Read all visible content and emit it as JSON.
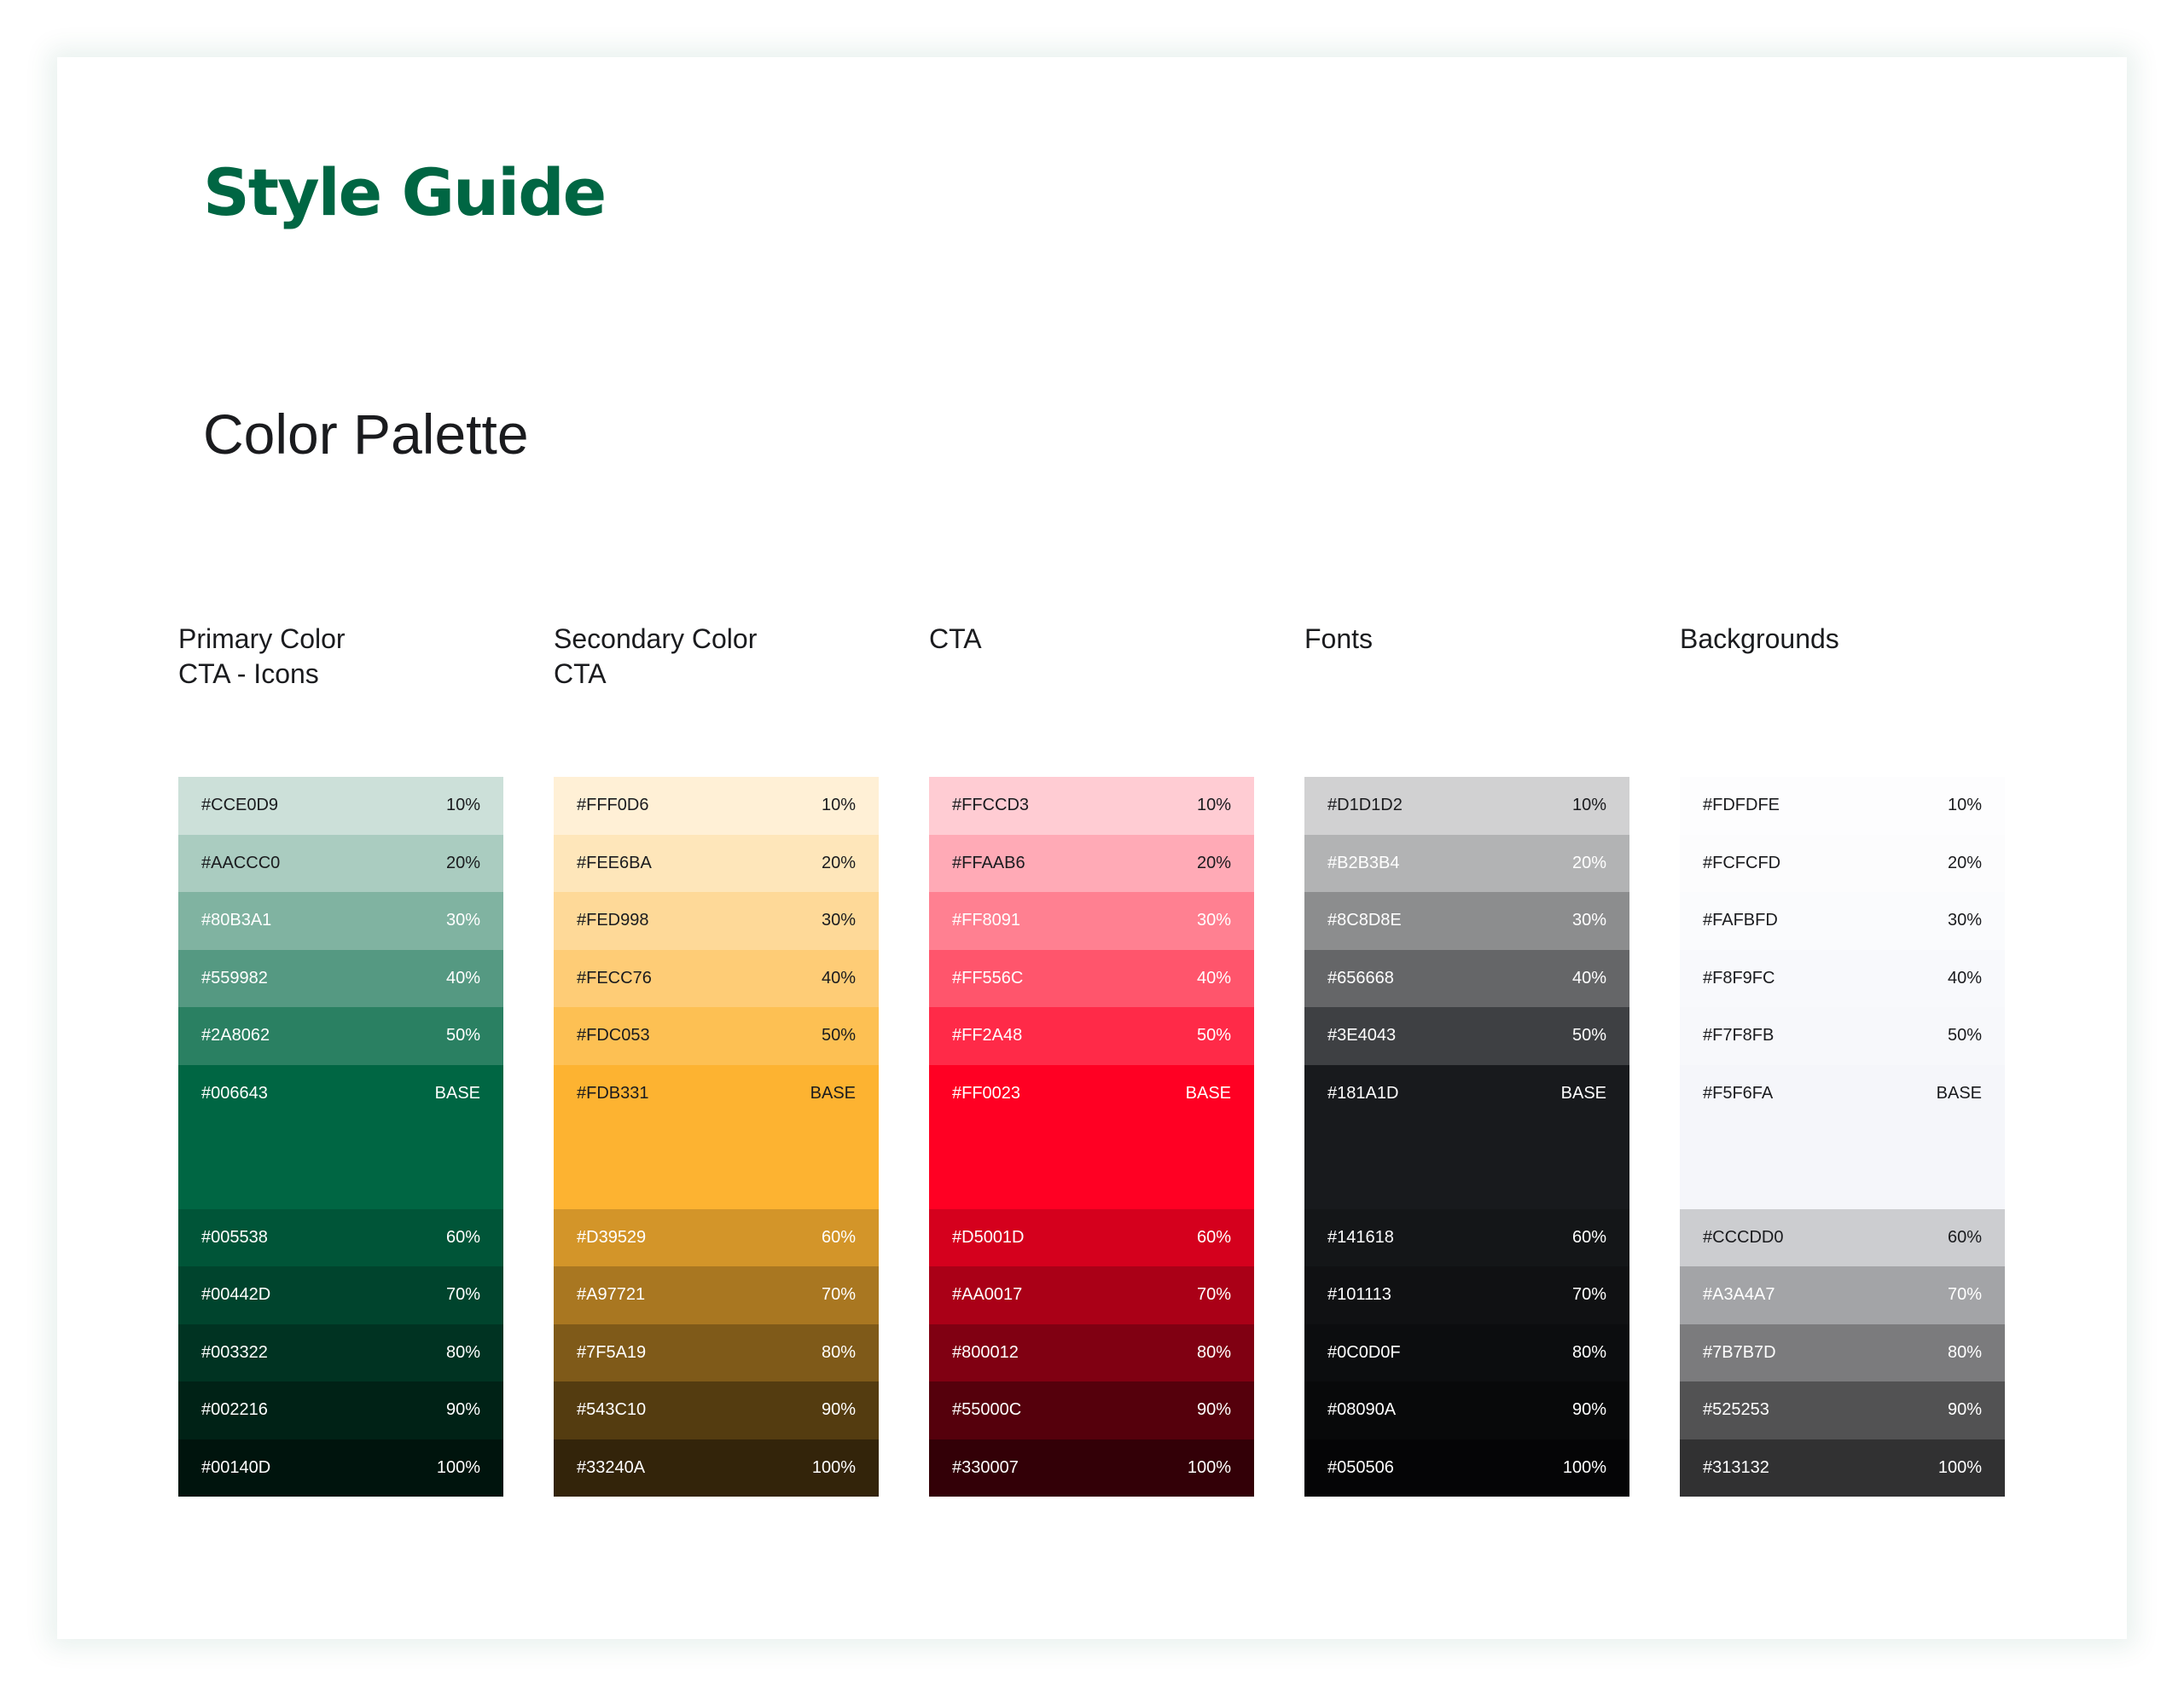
{
  "title": "Style Guide",
  "title_color": "#006643",
  "subtitle": "Color Palette",
  "palettes": [
    {
      "id": "primary",
      "heading": [
        "Primary Color",
        "CTA - Icons"
      ],
      "swatches": [
        {
          "hex": "#CCE0D9",
          "label": "10%",
          "text": "#1a1b1e"
        },
        {
          "hex": "#AACCC0",
          "label": "20%",
          "text": "#1a1b1e"
        },
        {
          "hex": "#80B3A1",
          "label": "30%",
          "text": "#ffffff"
        },
        {
          "hex": "#559982",
          "label": "40%",
          "text": "#ffffff"
        },
        {
          "hex": "#2A8062",
          "label": "50%",
          "text": "#ffffff"
        },
        {
          "hex": "#006643",
          "label": "BASE",
          "text": "#ffffff",
          "base": true
        },
        {
          "hex": "#005538",
          "label": "60%",
          "text": "#ffffff"
        },
        {
          "hex": "#00442D",
          "label": "70%",
          "text": "#ffffff"
        },
        {
          "hex": "#003322",
          "label": "80%",
          "text": "#ffffff"
        },
        {
          "hex": "#002216",
          "label": "90%",
          "text": "#ffffff"
        },
        {
          "hex": "#00140D",
          "label": "100%",
          "text": "#ffffff"
        }
      ]
    },
    {
      "id": "secondary",
      "heading": [
        "Secondary Color",
        "CTA"
      ],
      "swatches": [
        {
          "hex": "#FFF0D6",
          "label": "10%",
          "text": "#1a1b1e"
        },
        {
          "hex": "#FEE6BA",
          "label": "20%",
          "text": "#1a1b1e"
        },
        {
          "hex": "#FED998",
          "label": "30%",
          "text": "#1a1b1e"
        },
        {
          "hex": "#FECC76",
          "label": "40%",
          "text": "#1a1b1e"
        },
        {
          "hex": "#FDC053",
          "label": "50%",
          "text": "#1a1b1e"
        },
        {
          "hex": "#FDB331",
          "label": "BASE",
          "text": "#1a1b1e",
          "base": true
        },
        {
          "hex": "#D39529",
          "label": "60%",
          "text": "#ffffff"
        },
        {
          "hex": "#A97721",
          "label": "70%",
          "text": "#ffffff"
        },
        {
          "hex": "#7F5A19",
          "label": "80%",
          "text": "#ffffff"
        },
        {
          "hex": "#543C10",
          "label": "90%",
          "text": "#ffffff"
        },
        {
          "hex": "#33240A",
          "label": "100%",
          "text": "#ffffff"
        }
      ]
    },
    {
      "id": "cta",
      "heading": [
        "CTA"
      ],
      "swatches": [
        {
          "hex": "#FFCCD3",
          "label": "10%",
          "text": "#1a1b1e"
        },
        {
          "hex": "#FFAAB6",
          "label": "20%",
          "text": "#1a1b1e"
        },
        {
          "hex": "#FF8091",
          "label": "30%",
          "text": "#ffffff"
        },
        {
          "hex": "#FF556C",
          "label": "40%",
          "text": "#ffffff"
        },
        {
          "hex": "#FF2A48",
          "label": "50%",
          "text": "#ffffff"
        },
        {
          "hex": "#FF0023",
          "label": "BASE",
          "text": "#ffffff",
          "base": true
        },
        {
          "hex": "#D5001D",
          "label": "60%",
          "text": "#ffffff"
        },
        {
          "hex": "#AA0017",
          "label": "70%",
          "text": "#ffffff"
        },
        {
          "hex": "#800012",
          "label": "80%",
          "text": "#ffffff"
        },
        {
          "hex": "#55000C",
          "label": "90%",
          "text": "#ffffff"
        },
        {
          "hex": "#330007",
          "label": "100%",
          "text": "#ffffff"
        }
      ]
    },
    {
      "id": "fonts",
      "heading": [
        "Fonts"
      ],
      "swatches": [
        {
          "hex": "#D1D1D2",
          "label": "10%",
          "text": "#1a1b1e"
        },
        {
          "hex": "#B2B3B4",
          "label": "20%",
          "text": "#ffffff"
        },
        {
          "hex": "#8C8D8E",
          "label": "30%",
          "text": "#ffffff"
        },
        {
          "hex": "#656668",
          "label": "40%",
          "text": "#ffffff"
        },
        {
          "hex": "#3E4043",
          "label": "50%",
          "text": "#ffffff"
        },
        {
          "hex": "#181A1D",
          "label": "BASE",
          "text": "#ffffff",
          "base": true
        },
        {
          "hex": "#141618",
          "label": "60%",
          "text": "#ffffff"
        },
        {
          "hex": "#101113",
          "label": "70%",
          "text": "#ffffff"
        },
        {
          "hex": "#0C0D0F",
          "label": "80%",
          "text": "#ffffff"
        },
        {
          "hex": "#08090A",
          "label": "90%",
          "text": "#ffffff"
        },
        {
          "hex": "#050506",
          "label": "100%",
          "text": "#ffffff"
        }
      ]
    },
    {
      "id": "backgrounds",
      "heading": [
        "Backgrounds"
      ],
      "swatches": [
        {
          "hex": "#FDFDFE",
          "label": "10%",
          "text": "#1a1b1e"
        },
        {
          "hex": "#FCFCFD",
          "label": "20%",
          "text": "#1a1b1e"
        },
        {
          "hex": "#FAFBFD",
          "label": "30%",
          "text": "#1a1b1e"
        },
        {
          "hex": "#F8F9FC",
          "label": "40%",
          "text": "#1a1b1e"
        },
        {
          "hex": "#F7F8FB",
          "label": "50%",
          "text": "#1a1b1e"
        },
        {
          "hex": "#F5F6FA",
          "label": "BASE",
          "text": "#1a1b1e",
          "base": true
        },
        {
          "hex": "#CCCDD0",
          "label": "60%",
          "text": "#1a1b1e"
        },
        {
          "hex": "#A3A4A7",
          "label": "70%",
          "text": "#ffffff"
        },
        {
          "hex": "#7B7B7D",
          "label": "80%",
          "text": "#ffffff"
        },
        {
          "hex": "#525253",
          "label": "90%",
          "text": "#ffffff"
        },
        {
          "hex": "#313132",
          "label": "100%",
          "text": "#ffffff"
        }
      ]
    }
  ]
}
